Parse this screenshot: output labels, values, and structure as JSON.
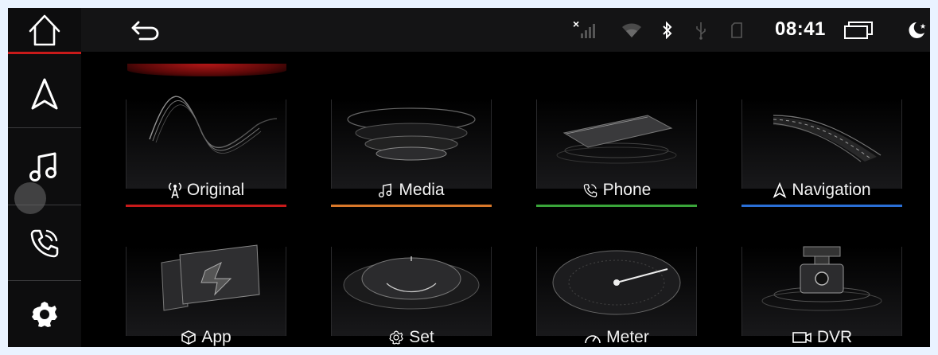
{
  "status_bar": {
    "time": "08:41",
    "signal_x": "×"
  },
  "colors": {
    "accent_red": "#c81a1a",
    "orange": "#d9782a",
    "green": "#3aa53a",
    "blue": "#2a6fd6"
  },
  "sidebar": {
    "items": [
      {
        "name": "home",
        "icon": "home-icon"
      },
      {
        "name": "navigation",
        "icon": "navigation-arrow-icon"
      },
      {
        "name": "music",
        "icon": "music-note-icon"
      },
      {
        "name": "phone",
        "icon": "phone-icon"
      },
      {
        "name": "settings",
        "icon": "gear-icon"
      }
    ]
  },
  "tiles": [
    {
      "label": "Original",
      "icon": "antenna-icon",
      "bar_color": "#c81a1a"
    },
    {
      "label": "Media",
      "icon": "music-note-icon",
      "bar_color": "#d9782a"
    },
    {
      "label": "Phone",
      "icon": "phone-icon",
      "bar_color": "#3aa53a"
    },
    {
      "label": "Navigation",
      "icon": "navigation-arrow-icon",
      "bar_color": "#2a6fd6"
    },
    {
      "label": "App",
      "icon": "cube-icon",
      "bar_color": "#3aa53a"
    },
    {
      "label": "Set",
      "icon": "gear-icon",
      "bar_color": "#2a6fd6"
    },
    {
      "label": "Meter",
      "icon": "gauge-icon",
      "bar_color": "#c81a1a"
    },
    {
      "label": "DVR",
      "icon": "camera-icon",
      "bar_color": "#d9782a"
    }
  ]
}
